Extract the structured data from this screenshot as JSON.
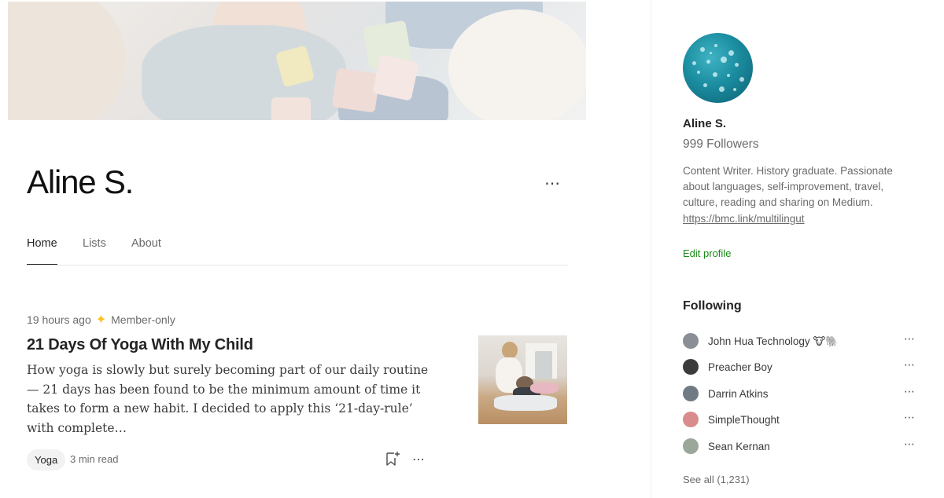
{
  "profile": {
    "name": "Aline S."
  },
  "tabs": [
    {
      "label": "Home",
      "active": true
    },
    {
      "label": "Lists",
      "active": false
    },
    {
      "label": "About",
      "active": false
    }
  ],
  "post": {
    "time": "19 hours ago",
    "membership": "Member-only",
    "title": "21 Days Of Yoga With My Child",
    "excerpt": "How yoga is slowly but surely becoming part of our daily routine — 21 days has been found to be the minimum amount of time it takes to form a new habit. I decided to apply this ‘21-day-rule’ with complete…",
    "tag": "Yoga",
    "read_time": "3 min read"
  },
  "sidebar": {
    "name": "Aline S.",
    "followers": "999 Followers",
    "bio": "Content Writer. History graduate. Passionate about languages, self-improvement, travel, culture, reading and sharing on Medium.",
    "link": "https://bmc.link/multilingut",
    "edit_profile": "Edit profile",
    "following_title": "Following",
    "following": [
      {
        "name": "John Hua Technology 🐮🐘",
        "avatar_color": "#8a8f96"
      },
      {
        "name": "Preacher Boy",
        "avatar_color": "#3b3b3b"
      },
      {
        "name": "Darrin Atkins",
        "avatar_color": "#6f7a84"
      },
      {
        "name": "SimpleThought",
        "avatar_color": "#d98c8c"
      },
      {
        "name": "Sean Kernan",
        "avatar_color": "#9aa79a"
      }
    ],
    "see_all": "See all (1,231)"
  },
  "icons": {
    "more": "⋯",
    "sparkle": "✦"
  },
  "colors": {
    "accent_green": "#1a8917",
    "member_star": "#ffc017"
  }
}
